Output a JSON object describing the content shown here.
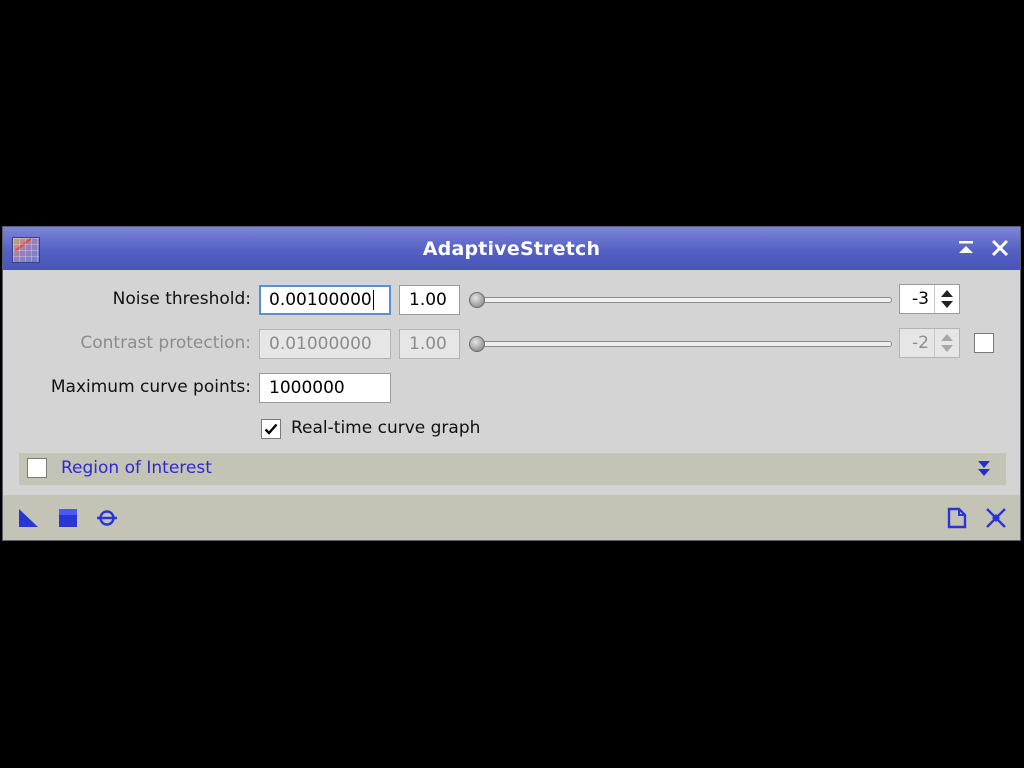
{
  "window": {
    "title": "AdaptiveStretch"
  },
  "noise_threshold": {
    "label": "Noise threshold:",
    "value": "0.00100000",
    "mantissa": "1.00",
    "exponent": "-3",
    "slider_fraction": 0.0
  },
  "contrast_protection": {
    "label": "Contrast protection:",
    "value": "0.01000000",
    "mantissa": "1.00",
    "exponent": "-2",
    "slider_fraction": 0.0,
    "enabled": false
  },
  "max_curve_points": {
    "label": "Maximum curve points:",
    "value": "1000000"
  },
  "realtime_graph": {
    "label": "Real-time curve graph",
    "checked": true
  },
  "region_of_interest": {
    "label": "Region of Interest",
    "checked": false
  },
  "colors": {
    "title_bar": "#5560c4",
    "link_blue": "#2a2ad0",
    "panel": "#d4d4d4",
    "section_bar": "#c4c4b6"
  },
  "icons": {
    "bottom_left": [
      "new-instance-icon",
      "apply-global-icon",
      "preview-icon"
    ],
    "bottom_right": [
      "documentation-icon",
      "reset-icon"
    ],
    "title": [
      "app-icon",
      "shade-icon",
      "close-icon"
    ]
  }
}
